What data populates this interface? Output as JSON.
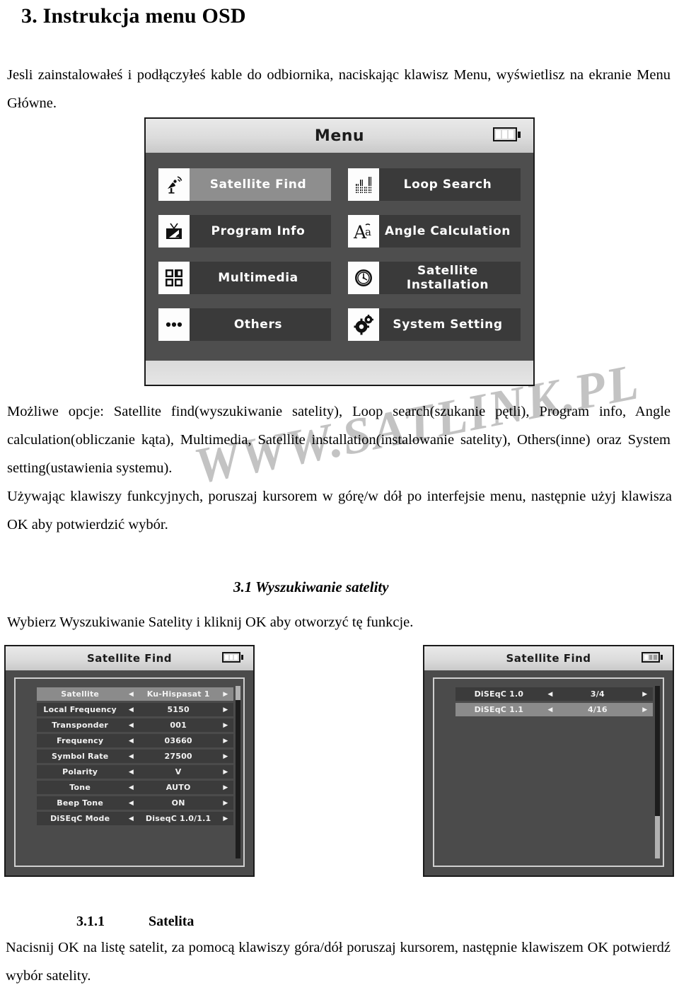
{
  "document": {
    "heading": "3. Instrukcja menu OSD",
    "intro_paragraph": "Jesli zainstalowałeś i podłączyłeś kable do odbiornika, naciskając klawisz Menu, wyświetlisz na ekranie Menu Główne.",
    "options_paragraph": "Możliwe opcje: Satellite find(wyszukiwanie satelity), Loop search(szukanie pętli), Program info, Angle calculation(obliczanie kąta), Multimedia, Satellite installation(instalowanie satelity), Others(inne) oraz System setting(ustawienia systemu).",
    "navigation_paragraph": "Używając klawiszy funkcyjnych, poruszaj kursorem w górę/w dół po interfejsie menu, następnie użyj klawisza OK aby potwierdzić wybór.",
    "section_31_heading": "3.1 Wyszukiwanie satelity",
    "section_31_paragraph": "Wybierz Wyszukiwanie Satelity i kliknij OK aby otworzyć tę funkcje.",
    "section_311_number": "3.1.1",
    "section_311_title": "Satelita",
    "section_311_paragraph": "Nacisnij OK na listę satelit, za pomocą klawiszy góra/dół poruszaj kursorem, następnie klawiszem OK potwierdź wybór satelity.",
    "watermark": "WWW.SATLINK.PL"
  },
  "menu_screen": {
    "title": "Menu",
    "battery_icon": "battery-icon",
    "battery_level_bars": 3,
    "items": [
      {
        "label": "Satellite Find",
        "icon": "satellite-dish-icon",
        "selected": true
      },
      {
        "label": "Loop Search",
        "icon": "bar-chart-icon",
        "selected": false
      },
      {
        "label": "Program Info",
        "icon": "television-icon",
        "selected": false
      },
      {
        "label": "Angle Calculation",
        "icon": "letters-aa-icon",
        "selected": false
      },
      {
        "label": "Multimedia",
        "icon": "grid-squares-icon",
        "selected": false
      },
      {
        "label": "Satellite Installation",
        "icon": "globe-clock-icon",
        "selected": false
      },
      {
        "label": "Others",
        "icon": "three-dots-icon",
        "selected": false
      },
      {
        "label": "System Setting",
        "icon": "gears-icon",
        "selected": false
      }
    ]
  },
  "satellite_find_left": {
    "title": "Satellite Find",
    "battery_icon": "battery-icon",
    "battery_level_bars": 3,
    "left_arrow": "◀",
    "right_arrow": "▶",
    "rows": [
      {
        "label": "Satellite",
        "value": "Ku-Hispasat 1",
        "selected": true
      },
      {
        "label": "Local Frequency",
        "value": "5150",
        "selected": false
      },
      {
        "label": "Transponder",
        "value": "001",
        "selected": false
      },
      {
        "label": "Frequency",
        "value": "03660",
        "selected": false
      },
      {
        "label": "Symbol Rate",
        "value": "27500",
        "selected": false
      },
      {
        "label": "Polarity",
        "value": "V",
        "selected": false
      },
      {
        "label": "Tone",
        "value": "AUTO",
        "selected": false
      },
      {
        "label": "Beep Tone",
        "value": "ON",
        "selected": false
      },
      {
        "label": "DiSEqC Mode",
        "value": "DiseqC 1.0/1.1",
        "selected": false
      }
    ]
  },
  "satellite_find_right": {
    "title": "Satellite Find",
    "battery_icon": "battery-icon",
    "battery_level_bars": 1,
    "left_arrow": "◀",
    "right_arrow": "▶",
    "rows": [
      {
        "label": "DiSEqC 1.0",
        "value": "3/4",
        "selected": false
      },
      {
        "label": "DiSEqC 1.1",
        "value": "4/16",
        "selected": true
      }
    ]
  },
  "colors": {
    "page_background": "#ffffff",
    "text": "#000000",
    "osd_background": "#4a4a4a",
    "osd_row": "#3a3a3a",
    "osd_row_selected": "#8e8e8e",
    "osd_titlebar": "#dcdcdc",
    "watermark": "#b9b9b9"
  }
}
